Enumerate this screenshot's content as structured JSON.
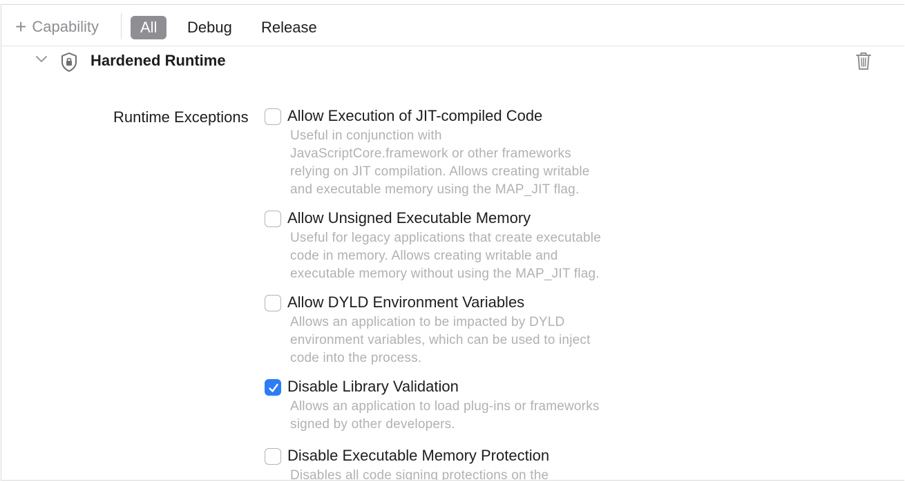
{
  "toolbar": {
    "add_capability_label": "Capability",
    "add_capability_icon": "plus-icon",
    "tabs": [
      {
        "label": "All",
        "selected": true
      },
      {
        "label": "Debug",
        "selected": false
      },
      {
        "label": "Release",
        "selected": false
      }
    ]
  },
  "section": {
    "title": "Hardened Runtime",
    "expanded": true,
    "icons": [
      "chevron-down-icon",
      "shield-lock-icon",
      "trash-icon"
    ]
  },
  "runtime_exceptions": {
    "label": "Runtime Exceptions",
    "options": [
      {
        "title": "Allow Execution of JIT-compiled Code",
        "checked": false,
        "description": [
          "Useful in conjunction with",
          "JavaScriptCore.framework or other frameworks",
          "relying on JIT compilation. Allows creating writable",
          "and executable memory using the MAP_JIT flag."
        ]
      },
      {
        "title": "Allow Unsigned Executable Memory",
        "checked": false,
        "description": [
          "Useful for legacy applications that create executable",
          "code in memory. Allows creating writable and",
          "executable memory without using the MAP_JIT flag."
        ]
      },
      {
        "title": "Allow DYLD Environment Variables",
        "checked": false,
        "description": [
          "Allows an application to be impacted by DYLD",
          "environment variables, which can be used to inject",
          "code into the process."
        ]
      },
      {
        "title": "Disable Library Validation",
        "checked": true,
        "description": [
          "Allows an application to load plug-ins or frameworks",
          "signed by other developers."
        ]
      },
      {
        "title": "Disable Executable Memory Protection",
        "checked": false,
        "description": [
          "Disables all code signing protections on the"
        ]
      }
    ]
  },
  "colors": {
    "accent": "#2d7cf6",
    "selected_tab_bg": "#8f8f93",
    "description_text": "#b1b1b5"
  }
}
